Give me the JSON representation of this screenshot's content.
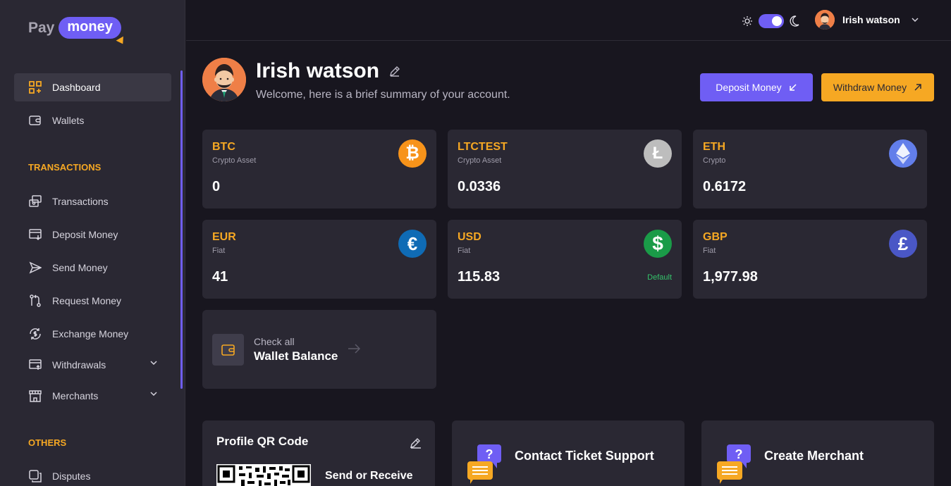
{
  "brand": {
    "pay": "Pay",
    "money": "money"
  },
  "sidebar": {
    "items": [
      {
        "label": "Dashboard",
        "icon": "dashboard-grid-icon"
      },
      {
        "label": "Wallets",
        "icon": "wallet-icon"
      },
      {
        "label": "Transactions",
        "icon": "transactions-icon"
      },
      {
        "label": "Deposit Money",
        "icon": "deposit-icon"
      },
      {
        "label": "Send Money",
        "icon": "send-icon"
      },
      {
        "label": "Request Money",
        "icon": "request-icon"
      },
      {
        "label": "Exchange Money",
        "icon": "exchange-icon"
      },
      {
        "label": "Withdrawals",
        "icon": "withdraw-icon"
      },
      {
        "label": "Merchants",
        "icon": "merchant-store-icon"
      },
      {
        "label": "Disputes",
        "icon": "disputes-icon"
      }
    ],
    "sections": {
      "transactions": "TRANSACTIONS",
      "others": "OTHERS"
    }
  },
  "topbar": {
    "user_name": "Irish watson"
  },
  "profile": {
    "name": "Irish watson",
    "welcome": "Welcome, here is a brief summary of your account."
  },
  "actions": {
    "deposit": "Deposit Money",
    "withdraw": "Withdraw Money"
  },
  "wallets": [
    {
      "code": "BTC",
      "type": "Crypto Asset",
      "balance": "0",
      "badge": "",
      "symbol": "₿",
      "color": "#f7931a"
    },
    {
      "code": "LTCTEST",
      "type": "Crypto Asset",
      "balance": "0.0336",
      "badge": "",
      "symbol": "Ł",
      "color": "#bdbdbd"
    },
    {
      "code": "ETH",
      "type": "Crypto",
      "balance": "0.6172",
      "badge": "",
      "symbol": "◆",
      "color": "#627eea"
    },
    {
      "code": "EUR",
      "type": "Fiat",
      "balance": "41",
      "badge": "",
      "symbol": "€",
      "color": "#0f6bb5"
    },
    {
      "code": "USD",
      "type": "Fiat",
      "balance": "115.83",
      "badge": "Default",
      "symbol": "$",
      "color": "#1a9b48"
    },
    {
      "code": "GBP",
      "type": "Fiat",
      "balance": "1,977.98",
      "badge": "",
      "symbol": "£",
      "color": "#4a57c6"
    }
  ],
  "wallet_balance": {
    "line1": "Check all",
    "line2": "Wallet Balance"
  },
  "qr": {
    "title": "Profile QR Code",
    "action": "Send or Receive"
  },
  "support": {
    "title": "Contact Ticket Support"
  },
  "merchant": {
    "title": "Create Merchant"
  },
  "colors": {
    "accent": "#6f5ef4",
    "orange": "#f6a823",
    "bg": "#18161f",
    "panel": "#2a2833"
  }
}
